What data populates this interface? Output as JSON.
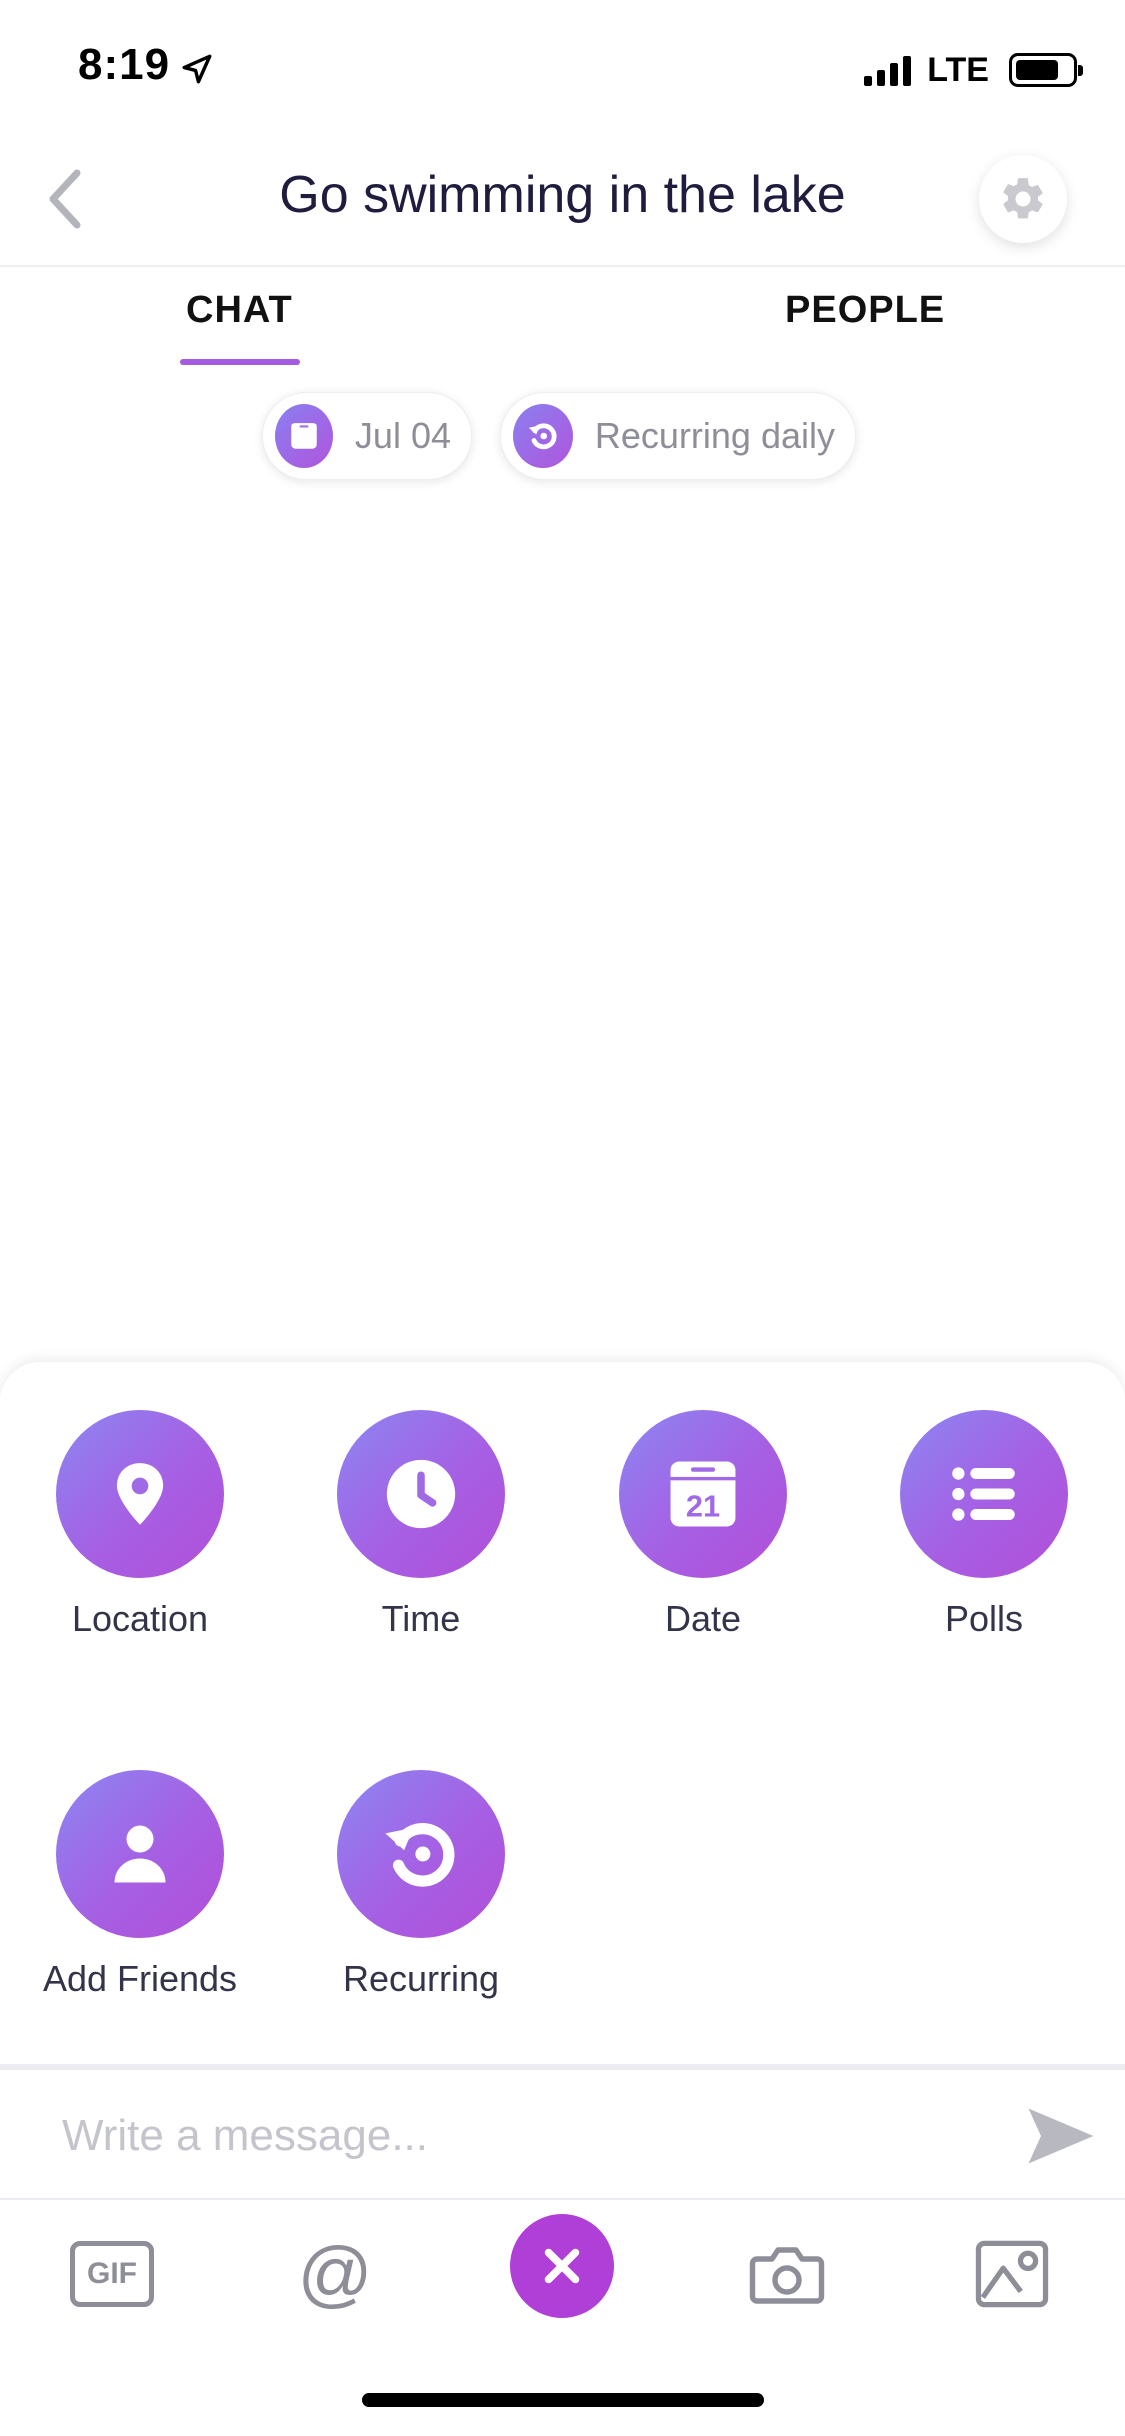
{
  "status_bar": {
    "time": "8:19",
    "network": "LTE"
  },
  "header": {
    "title": "Go swimming in the lake"
  },
  "tabs": [
    {
      "label": "CHAT",
      "active": true
    },
    {
      "label": "PEOPLE",
      "active": false
    }
  ],
  "chips": {
    "date": {
      "label": "Jul 04",
      "icon": "calendar-icon"
    },
    "recurring": {
      "label": "Recurring daily",
      "icon": "recurring-icon"
    }
  },
  "actions": [
    {
      "label": "Location",
      "icon": "location-pin-icon"
    },
    {
      "label": "Time",
      "icon": "clock-icon"
    },
    {
      "label": "Date",
      "icon": "calendar-icon",
      "day": "21"
    },
    {
      "label": "Polls",
      "icon": "list-icon"
    },
    {
      "label": "Add Friends",
      "icon": "person-icon"
    },
    {
      "label": "Recurring",
      "icon": "recurring-icon"
    }
  ],
  "message": {
    "placeholder": "Write a message..."
  },
  "toolbar": {
    "gif_label": "GIF",
    "at_label": "@"
  },
  "colors": {
    "accent": "#b03fd8",
    "gradient_start": "#8c86f2",
    "gradient_end": "#b24fd9",
    "title": "#1f1c3d"
  }
}
